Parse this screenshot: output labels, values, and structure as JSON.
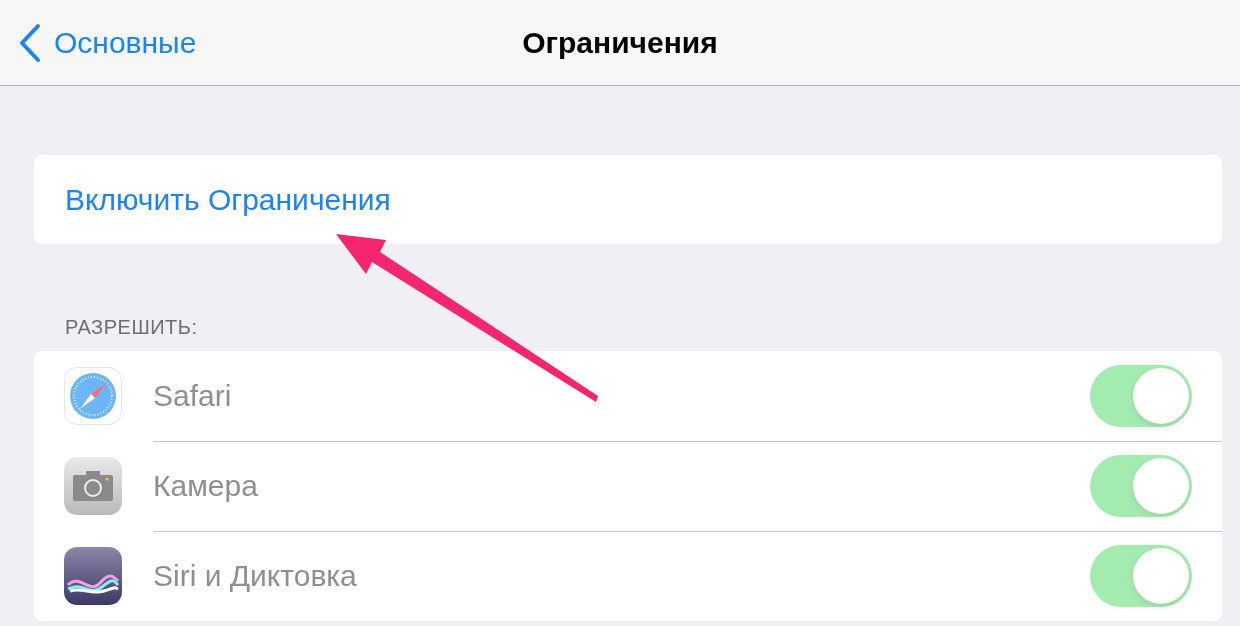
{
  "nav_bar": {
    "back_label": "Основные",
    "title": "Ограничения"
  },
  "enable_button": {
    "label": "Включить Ограничения"
  },
  "section_header": "РАЗРЕШИТЬ:",
  "rows": [
    {
      "label": "Safari",
      "on": true,
      "disabled": true
    },
    {
      "label": "Камера",
      "on": true,
      "disabled": true
    },
    {
      "label": "Siri и Диктовка",
      "on": true,
      "disabled": true
    }
  ]
}
